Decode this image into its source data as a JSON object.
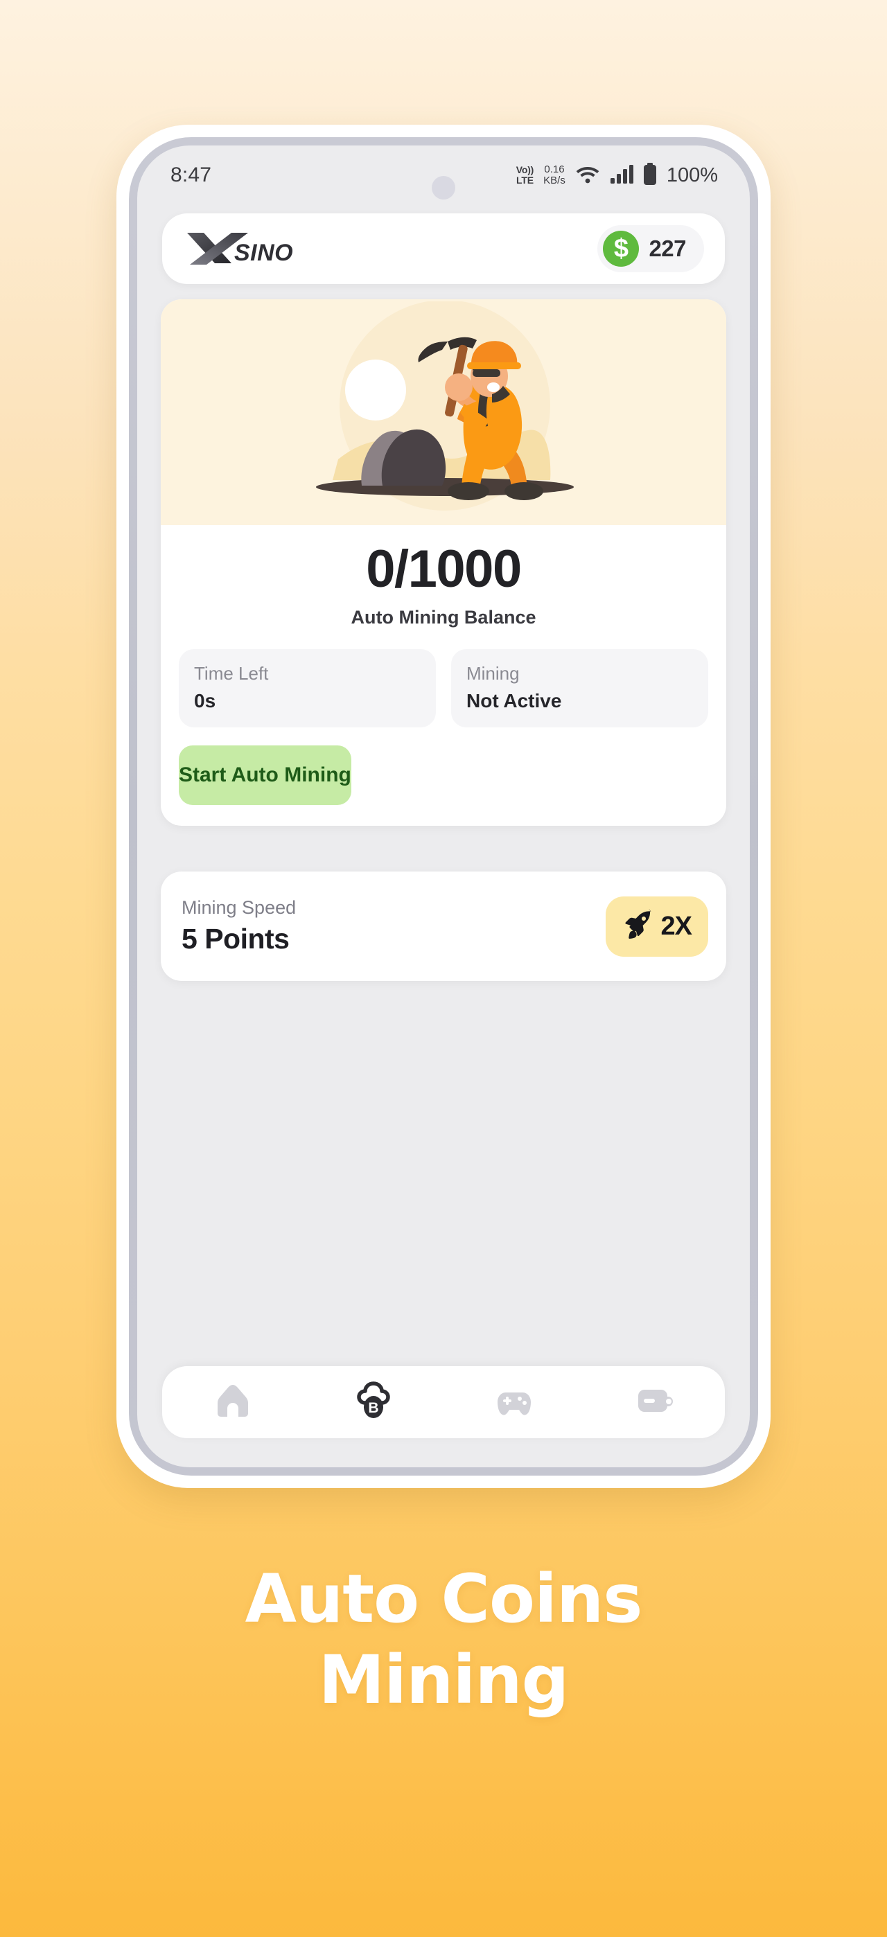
{
  "background": {
    "gradient_top": "#FEF2E0",
    "gradient_bottom": "#FCB93D"
  },
  "phone": {
    "statusbar": {
      "time": "8:47",
      "volte_top": "Vo))",
      "volte_bottom": "LTE",
      "netspeed_value": "0.16",
      "netspeed_unit": "KB/s",
      "wifi_icon": "wifi-icon",
      "signal_icon": "cellular-signal-icon",
      "battery_icon": "battery-full-icon",
      "battery_percent": "100%"
    },
    "header": {
      "logo_text": "XSINO",
      "logo_mark": "x-logo-icon",
      "coin_icon": "dollar-coin-icon",
      "coin_symbol": "$",
      "balance": "227"
    },
    "mining_card": {
      "illustration": "miner-with-pickaxe-illustration",
      "balance_value": "0/1000",
      "balance_label": "Auto Mining Balance",
      "stats": [
        {
          "label": "Time Left",
          "value": "0s"
        },
        {
          "label": "Mining",
          "value": "Not Active"
        }
      ],
      "start_button": "Start Auto Mining",
      "button_color": "#C6EBA5",
      "button_text_color": "#1E5B18"
    },
    "speed_card": {
      "label": "Mining Speed",
      "value": "5 Points",
      "boost_icon": "rocket-icon",
      "boost_multiplier": "2X",
      "boost_bg": "#FCE8A6"
    },
    "bottom_nav": [
      {
        "name": "home",
        "icon": "home-icon",
        "active": false
      },
      {
        "name": "mining",
        "icon": "cloud-bitcoin-icon",
        "active": true
      },
      {
        "name": "games",
        "icon": "gamepad-icon",
        "active": false
      },
      {
        "name": "wallet",
        "icon": "wallet-icon",
        "active": false
      }
    ]
  },
  "headline": {
    "line1": "Auto Coins",
    "line2": "Mining"
  }
}
